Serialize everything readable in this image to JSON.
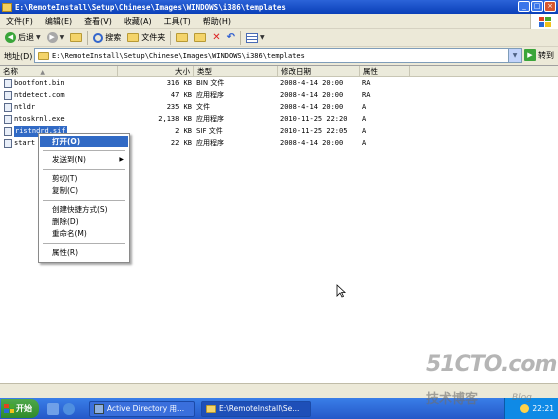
{
  "window": {
    "title": "E:\\RemoteInstall\\Setup\\Chinese\\Images\\WINDOWS\\i386\\templates",
    "min_glyph": "_",
    "max_glyph": "□",
    "close_glyph": "×"
  },
  "menubar": {
    "items": [
      "文件(F)",
      "编辑(E)",
      "查看(V)",
      "收藏(A)",
      "工具(T)",
      "帮助(H)"
    ]
  },
  "toolbar": {
    "back_label": "后退",
    "search_label": "搜索",
    "folders_label": "文件夹"
  },
  "addressbar": {
    "label": "地址(D)",
    "path": "E:\\RemoteInstall\\Setup\\Chinese\\Images\\WINDOWS\\i386\\templates",
    "go_label": "转到"
  },
  "columns": {
    "name": "名称",
    "size": "大小",
    "type": "类型",
    "date": "修改日期",
    "attr": "属性"
  },
  "files": [
    {
      "name": "bootfont.bin",
      "size": "316 KB",
      "type": "BIN 文件",
      "date": "2008-4-14 20:00",
      "attr": "RA"
    },
    {
      "name": "ntdetect.com",
      "size": "47 KB",
      "type": "应用程序",
      "date": "2008-4-14 20:00",
      "attr": "RA"
    },
    {
      "name": "ntldr",
      "size": "235 KB",
      "type": "文件",
      "date": "2008-4-14 20:00",
      "attr": "A"
    },
    {
      "name": "ntoskrnl.exe",
      "size": "2,138 KB",
      "type": "应用程序",
      "date": "2010-11-25 22:20",
      "attr": "A"
    },
    {
      "name": "ristndrd.sif",
      "size": "2 KB",
      "type": "SIF 文件",
      "date": "2010-11-25 22:05",
      "attr": "A"
    },
    {
      "name": "start",
      "size": "22 KB",
      "type": "应用程序",
      "date": "2008-4-14 20:00",
      "attr": "A"
    }
  ],
  "context_menu": {
    "open": "打开(O)",
    "send_to": "发送到(N)",
    "cut": "剪切(T)",
    "copy": "复制(C)",
    "create_shortcut": "创建快捷方式(S)",
    "delete": "删除(D)",
    "rename": "重命名(M)",
    "properties": "属性(R)"
  },
  "taskbar": {
    "start_label": "开始",
    "task1": "Active Directory 用...",
    "task2": "E:\\RemoteInstall\\Se...",
    "clock": "22:21"
  },
  "watermark": {
    "site": "51CTO.com",
    "tagline": "技术博客",
    "blog": "Blog"
  },
  "colors": {
    "title_bar": "#0a3fb8",
    "selection": "#316ac5",
    "taskbar": "#2458c8",
    "start_button": "#2f8a2c"
  }
}
